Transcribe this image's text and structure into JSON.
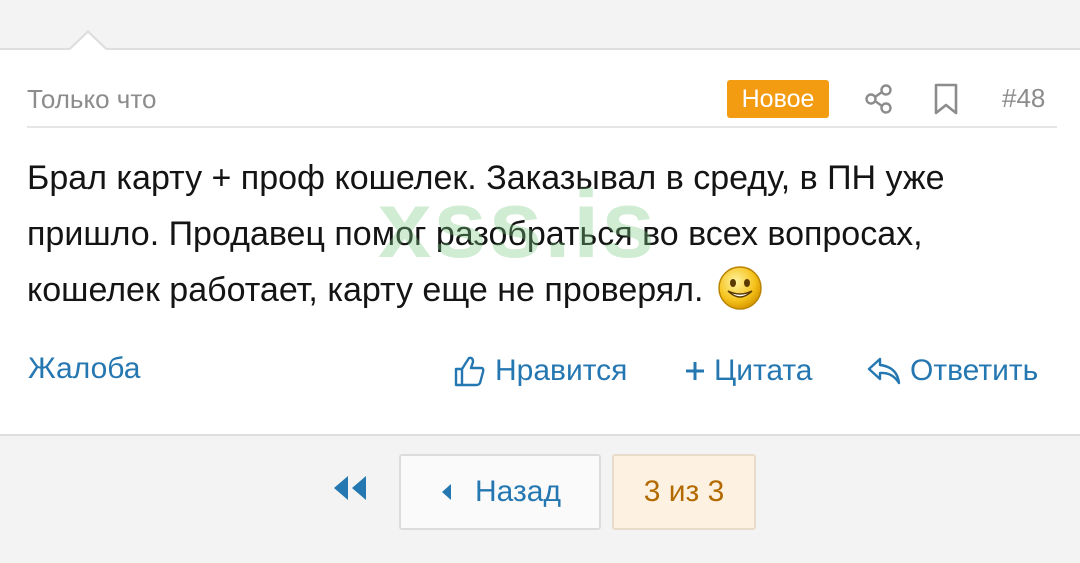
{
  "post": {
    "time": "Только что",
    "new_badge": "Новое",
    "number": "#48",
    "body": "Брал карту + проф кошелек. Заказывал в среду, в ПН уже пришло. Продавец помог разобраться во всех вопросах, кошелек работает, карту еще не проверял.",
    "watermark": "xss.is"
  },
  "actions": {
    "report": "Жалоба",
    "like": "Нравится",
    "quote": "Цитата",
    "reply": "Ответить"
  },
  "pagination": {
    "back": "Назад",
    "page_indicator": "3 из 3"
  },
  "colors": {
    "link": "#2577b1",
    "badge": "#f39c12",
    "page_text": "#b36b00"
  },
  "icons": [
    "avatar-icon",
    "share-icon",
    "bookmark-icon",
    "smiley-icon",
    "thumbs-up-icon",
    "plus-icon",
    "reply-arrow-icon",
    "double-left-arrow-icon",
    "caret-left-icon"
  ]
}
